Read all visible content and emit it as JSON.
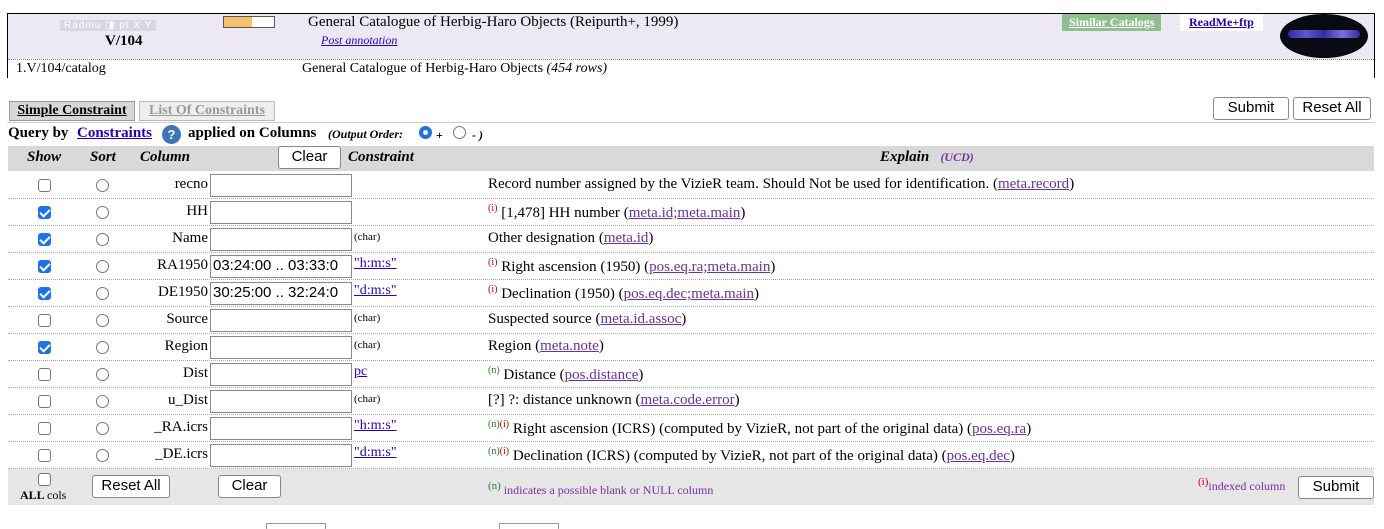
{
  "header": {
    "logo_text": "Radmu ◨ pt X Y",
    "catalog_id": "V/104",
    "progress_fraction": 0.55,
    "title": "General Catalogue of Herbig-Haro Objects (Reipurth+, 1999)",
    "post_annotation": "Post annotation",
    "similar_catalogs": "Similar Catalogs",
    "readme": "ReadMe+ftp",
    "table_path": "1.V/104/catalog",
    "table_desc": "General Catalogue of Herbig-Haro Objects",
    "table_rows": "(454 rows)"
  },
  "tabs": {
    "simple": "Simple Constraint",
    "list": "List Of Constraints"
  },
  "buttons": {
    "submit": "Submit",
    "reset_all": "Reset All",
    "clear": "Clear"
  },
  "query": {
    "query_by": "Query by",
    "constraints_link": "Constraints",
    "applied": "applied on Columns",
    "output_order": "(Output Order:",
    "plus": "+",
    "minus": "- )"
  },
  "columns_header": {
    "show": "Show",
    "sort": "Sort",
    "column": "Column",
    "constraint": "Constraint",
    "explain": "Explain",
    "ucd": "(UCD)"
  },
  "rows": [
    {
      "name": "recno",
      "show": false,
      "value": "",
      "unit": "",
      "unit_link": false,
      "flags": "",
      "explain": "Record number assigned by the VizieR team. Should Not be used for identification.",
      "ucd": "meta.record"
    },
    {
      "name": "HH",
      "show": true,
      "value": "",
      "unit": "",
      "unit_link": false,
      "flags": "(i)",
      "explain": "[1,478] HH number",
      "ucd": "meta.id;meta.main"
    },
    {
      "name": "Name",
      "show": true,
      "value": "",
      "unit": "(char)",
      "unit_link": false,
      "flags": "",
      "explain": "Other designation",
      "ucd": "meta.id"
    },
    {
      "name": "RA1950",
      "show": true,
      "value": "03:24:00 .. 03:33:0",
      "unit": "\"h:m:s\"",
      "unit_link": true,
      "flags": "(i)",
      "explain": "Right ascension (1950)",
      "ucd": "pos.eq.ra;meta.main"
    },
    {
      "name": "DE1950",
      "show": true,
      "value": "30:25:00 .. 32:24:0",
      "unit": "\"d:m:s\"",
      "unit_link": true,
      "flags": "(i)",
      "explain": "Declination (1950)",
      "ucd": "pos.eq.dec;meta.main"
    },
    {
      "name": "Source",
      "show": false,
      "value": "",
      "unit": "(char)",
      "unit_link": false,
      "flags": "",
      "explain": "Suspected source",
      "ucd": "meta.id.assoc"
    },
    {
      "name": "Region",
      "show": true,
      "value": "",
      "unit": "(char)",
      "unit_link": false,
      "flags": "",
      "explain": "Region",
      "ucd": "meta.note"
    },
    {
      "name": "Dist",
      "show": false,
      "value": "",
      "unit": "pc",
      "unit_link": true,
      "flags": "(n)",
      "explain": "Distance",
      "ucd": "pos.distance"
    },
    {
      "name": "u_Dist",
      "show": false,
      "value": "",
      "unit": "(char)",
      "unit_link": false,
      "flags": "",
      "explain": "[?] ?: distance unknown",
      "ucd": "meta.code.error"
    },
    {
      "name": "_RA.icrs",
      "show": false,
      "value": "",
      "unit": "\"h:m:s\"",
      "unit_link": true,
      "flags": "(n)(i)",
      "explain": "Right ascension (ICRS) (computed by VizieR, not part of the original data)",
      "ucd": "pos.eq.ra"
    },
    {
      "name": "_DE.icrs",
      "show": false,
      "value": "",
      "unit": "\"d:m:s\"",
      "unit_link": true,
      "flags": "(n)(i)",
      "explain": "Declination (ICRS) (computed by VizieR, not part of the original data)",
      "ucd": "pos.eq.dec"
    }
  ],
  "footer": {
    "all": "ALL",
    "cols": "cols",
    "note_flag": "(n)",
    "note": "indicates a possible blank or NULL column",
    "indexed_flag": "(i)",
    "indexed": "indexed column"
  },
  "colors": {
    "link": "#2200cc",
    "ucd": "#6b2fa0",
    "header_bg": "#ece9f5",
    "checkbox": "#1a73e8"
  }
}
